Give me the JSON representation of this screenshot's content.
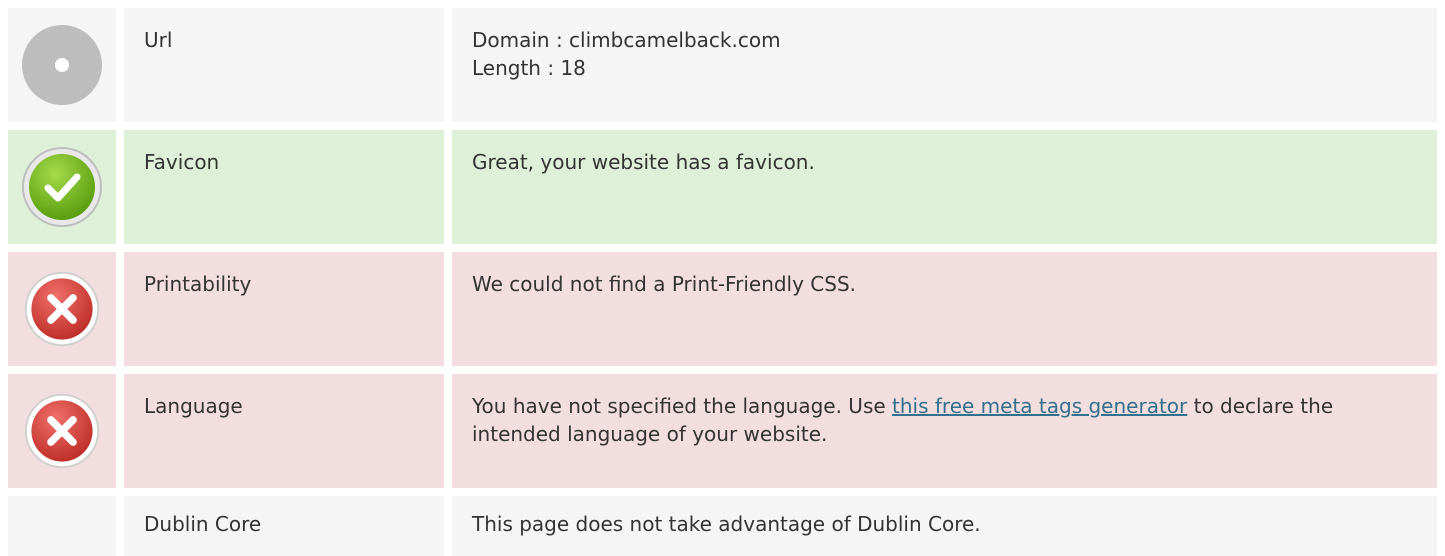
{
  "rows": [
    {
      "status": "neutral",
      "icon": "neutral-dot-icon",
      "label": "Url",
      "lines": [
        "Domain : climbcamelback.com",
        "Length : 18"
      ]
    },
    {
      "status": "good",
      "icon": "check-icon",
      "label": "Favicon",
      "text": "Great, your website has a favicon."
    },
    {
      "status": "bad",
      "icon": "cross-icon",
      "label": "Printability",
      "text": "We could not find a Print-Friendly CSS."
    },
    {
      "status": "bad",
      "icon": "cross-icon",
      "label": "Language",
      "text_before": "You have not specified the language. Use ",
      "link_text": "this free meta tags generator",
      "text_after": " to declare the intended language of your website."
    },
    {
      "status": "neutral",
      "icon": "",
      "label": "Dublin Core",
      "text": "This page does not take advantage of Dublin Core."
    }
  ],
  "colors": {
    "neutral_bg": "#f5f5f5",
    "good_bg": "#dff0d8",
    "bad_bg": "#f2dede",
    "link": "#31708f",
    "check_green": "#7cba2a",
    "cross_red": "#d9534f"
  }
}
